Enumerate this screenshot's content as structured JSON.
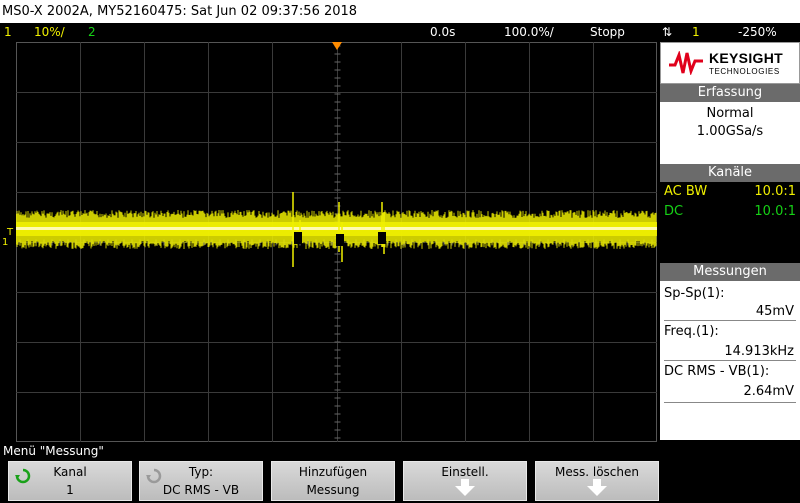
{
  "title": "MS0-X 2002A, MY52160475: Sat Jun 02 09:37:56 2018",
  "topbar": {
    "ch1_num": "1",
    "ch1_scale": "10%/",
    "ch2_num": "2",
    "time_offset": "0.0s",
    "time_scale": "100.0%/",
    "run_state": "Stopp",
    "trigger_edge": "⇅",
    "trigger_source": "1",
    "trigger_level": "-250%"
  },
  "brand": {
    "name": "KEYSIGHT",
    "sub": "TECHNOLOGIES"
  },
  "acquisition": {
    "header": "Erfassung",
    "mode": "Normal",
    "rate": "1.00GSa/s"
  },
  "channels": {
    "header": "Kanäle",
    "items": [
      {
        "coupling": "AC BW",
        "probe": "10.0:1",
        "color": "#f0f000"
      },
      {
        "coupling": "DC",
        "probe": "10.0:1",
        "color": "#16d116"
      }
    ]
  },
  "measurements": {
    "header": "Messungen",
    "items": [
      {
        "label": "Sp-Sp(1):",
        "value": "45mV"
      },
      {
        "label": "Freq.(1):",
        "value": "14.913kHz"
      },
      {
        "label": "DC RMS - VB(1):",
        "value": "2.64mV"
      }
    ]
  },
  "screen_markers": {
    "trigger": "T",
    "ground": "1"
  },
  "menu": {
    "title": "Menü \"Messung\"",
    "softkeys": [
      {
        "line1": "Kanal",
        "line2": "1"
      },
      {
        "line1": "Typ:",
        "line2": "DC RMS - VB"
      },
      {
        "line1": "Hinzufügen",
        "line2": "Messung"
      },
      {
        "line1": "Einstell.",
        "line2": ""
      },
      {
        "line1": "Mess. löschen",
        "line2": ""
      }
    ]
  },
  "colors": {
    "ch1": "#f0f000",
    "ch2": "#16d116",
    "trigger_marker": "#ff8c00"
  }
}
